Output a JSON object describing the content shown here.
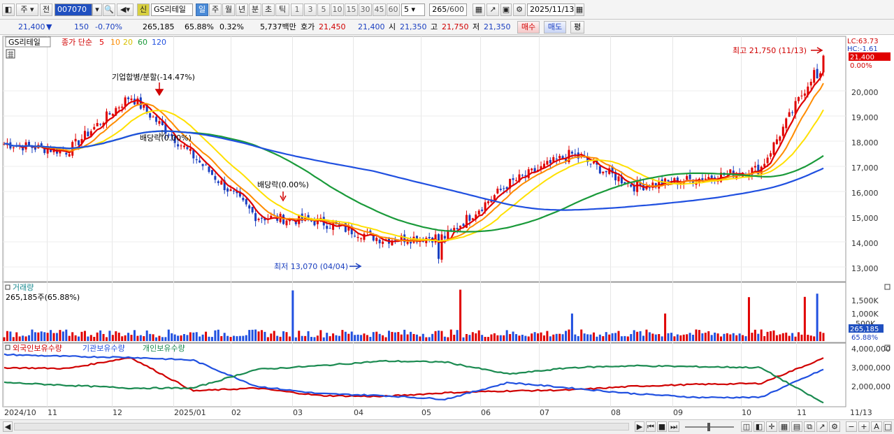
{
  "toolbar": {
    "period_d": "주",
    "prev_label": "전",
    "code_value": "007070",
    "badge_new": "신",
    "stock_name": "GS리테일",
    "periods": [
      "일",
      "주",
      "월",
      "년",
      "분",
      "초",
      "틱"
    ],
    "active_period": "일",
    "intervals": [
      "1",
      "3",
      "5",
      "10",
      "15",
      "30",
      "45",
      "60"
    ],
    "interval_select": "5",
    "count_value": "265",
    "count_total": "/600",
    "date_value": "2025/11/13"
  },
  "quote": {
    "price": "21,400",
    "change": "150",
    "change_pct": "-0.70%",
    "volume": "265,185",
    "vol_ratio": "65.88%",
    "turnover": "0.32%",
    "amount": "5,737백만",
    "ask_label": "호가",
    "ask": "21,450",
    "bid": "21,400",
    "open_label": "시",
    "open": "21,350",
    "high_label": "고",
    "high": "21,750",
    "low_label": "저",
    "low": "21,350",
    "buy_button": "매수",
    "sell_button": "매도",
    "eval_button": "평"
  },
  "price_panel": {
    "legend_stock": "GS리테일",
    "legend_ma_title": "종가 단순",
    "legend_ma": [
      "5",
      "10",
      "20",
      "60",
      "120"
    ],
    "ma_colors": [
      "#e00000",
      "#ff8c00",
      "#ffe000",
      "#1a9a3a",
      "#2050e0"
    ],
    "annotation_split": "기업합병/분할(-14.47%)",
    "annotation_div1": "배당락(0.00%)",
    "annotation_div2": "배당락(0.00%)",
    "annotation_high": "최고 21,750 (11/13)",
    "annotation_low": "최저 13,070 (04/04)",
    "axis_lc": "LC:63.73",
    "axis_hc": "HC:-1.61",
    "axis_price_badge": "21,400",
    "axis_pct_badge": "0.00%",
    "y_ticks": [
      "20,000",
      "19,000",
      "18,000",
      "17,000",
      "16,000",
      "15,000",
      "14,000",
      "13,000"
    ]
  },
  "volume_panel": {
    "title": "거래량",
    "summary": "265,185주(65.88%)",
    "y_ticks": [
      "1,500K",
      "1,000K",
      "500K"
    ],
    "badge_vol": "265,185",
    "badge_pct": "65.88%"
  },
  "holdings_panel": {
    "legend": [
      "외국인보유수량",
      "기관보유수량",
      "개인보유수량"
    ],
    "colors": [
      "#d00000",
      "#2050e0",
      "#1a8a50"
    ],
    "y_ticks": [
      "4,000,000",
      "3,000,000",
      "2,000,000"
    ]
  },
  "x_axis": {
    "labels": [
      "2024/10",
      "11",
      "12",
      "2025/01",
      "02",
      "03",
      "04",
      "05",
      "06",
      "07",
      "08",
      "09",
      "10",
      "11"
    ],
    "end_label": "11/13"
  },
  "chart_data": {
    "type": "candlestick",
    "ylim": [
      12600,
      21800
    ],
    "monthly_closes": [
      {
        "month": "2024/10",
        "close": 17900
      },
      {
        "month": "2024/11",
        "close": 17600
      },
      {
        "month": "2024/12",
        "close": 19800
      },
      {
        "month": "2025/01",
        "close": 17400
      },
      {
        "month": "2025/02",
        "close": 15000
      },
      {
        "month": "2025/03",
        "close": 14800
      },
      {
        "month": "2025/04",
        "close": 14100
      },
      {
        "month": "2025/05",
        "close": 14200
      },
      {
        "month": "2025/06",
        "close": 16300
      },
      {
        "month": "2025/07",
        "close": 17500
      },
      {
        "month": "2025/08",
        "close": 16200
      },
      {
        "month": "2025/09",
        "close": 16500
      },
      {
        "month": "2025/10",
        "close": 16900
      },
      {
        "month": "2025/11",
        "close": 21400
      }
    ],
    "high": {
      "value": 21750,
      "date": "11/13"
    },
    "low": {
      "value": 13070,
      "date": "04/04"
    },
    "last": 21400
  }
}
